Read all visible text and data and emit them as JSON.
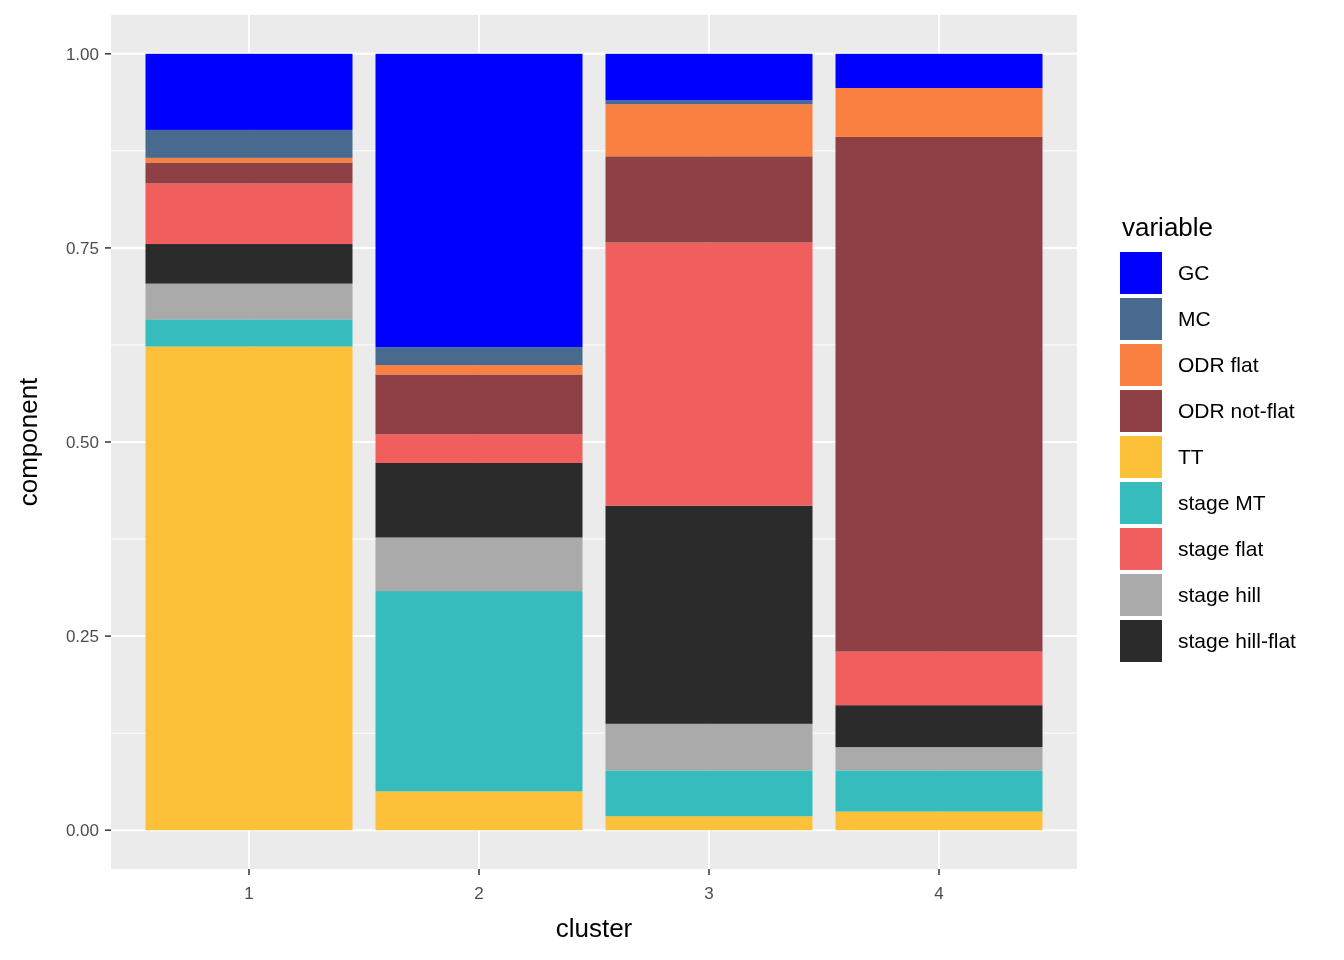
{
  "chart": {
    "chart_data": {
      "type": "bar",
      "stacked": true,
      "grid": true,
      "xlabel": "cluster",
      "ylabel": "component",
      "legend_title": "variable",
      "categories": [
        "1",
        "2",
        "3",
        "4"
      ],
      "ylim": [
        -0.05,
        1.05
      ],
      "yticks": [
        {
          "value": 0,
          "label": "0.00"
        },
        {
          "value": 0.25,
          "label": "0.25"
        },
        {
          "value": 0.5,
          "label": "0.50"
        },
        {
          "value": 0.75,
          "label": "0.75"
        },
        {
          "value": 1,
          "label": "1.00"
        }
      ],
      "series": [
        {
          "name": "TT",
          "color": "#fdc039",
          "values": [
            0.623,
            0.05,
            0.018,
            0.024
          ]
        },
        {
          "name": "stage MT",
          "color": "#36bcbc",
          "values": [
            0.035,
            0.258,
            0.059,
            0.053
          ]
        },
        {
          "name": "stage hill",
          "color": "#aaaaaa",
          "values": [
            0.046,
            0.069,
            0.06,
            0.03
          ]
        },
        {
          "name": "stage hill-flat",
          "color": "#2b2b2b",
          "values": [
            0.051,
            0.096,
            0.281,
            0.054
          ]
        },
        {
          "name": "stage flat",
          "color": "#f05f5e",
          "values": [
            0.078,
            0.037,
            0.339,
            0.069
          ]
        },
        {
          "name": "ODR not-flat",
          "color": "#8e4044",
          "values": [
            0.027,
            0.077,
            0.111,
            0.663
          ]
        },
        {
          "name": "ODR flat",
          "color": "#f98040",
          "values": [
            0.006,
            0.012,
            0.067,
            0.063
          ]
        },
        {
          "name": "MC",
          "color": "#476a8e",
          "values": [
            0.036,
            0.023,
            0.005,
            0
          ]
        },
        {
          "name": "GC",
          "color": "#0000ff",
          "values": [
            0.098,
            0.378,
            0.06,
            0.044
          ]
        }
      ]
    }
  }
}
